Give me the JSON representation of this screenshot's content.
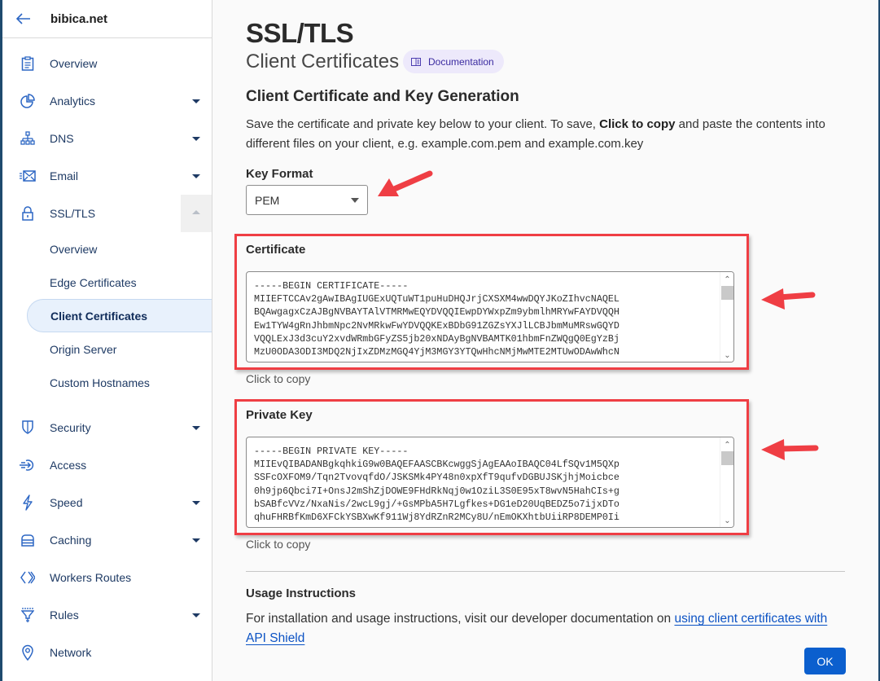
{
  "sidebar": {
    "site_name": "bibica.net",
    "back_icon": "arrow-left-icon",
    "items": [
      {
        "label": "Overview",
        "icon": "clipboard-icon",
        "has_caret": false
      },
      {
        "label": "Analytics",
        "icon": "pie-chart-icon",
        "has_caret": true
      },
      {
        "label": "DNS",
        "icon": "network-tree-icon",
        "has_caret": true
      },
      {
        "label": "Email",
        "icon": "email-icon",
        "has_caret": true
      },
      {
        "label": "SSL/TLS",
        "icon": "lock-icon",
        "expanded": true,
        "sub_items": [
          {
            "label": "Overview"
          },
          {
            "label": "Edge Certificates"
          },
          {
            "label": "Client Certificates",
            "active": true
          },
          {
            "label": "Origin Server"
          },
          {
            "label": "Custom Hostnames"
          }
        ]
      },
      {
        "label": "Security",
        "icon": "shield-icon",
        "has_caret": true
      },
      {
        "label": "Access",
        "icon": "access-icon",
        "has_caret": false
      },
      {
        "label": "Speed",
        "icon": "lightning-icon",
        "has_caret": true
      },
      {
        "label": "Caching",
        "icon": "storage-icon",
        "has_caret": true
      },
      {
        "label": "Workers Routes",
        "icon": "workers-icon",
        "has_caret": false
      },
      {
        "label": "Rules",
        "icon": "funnel-icon",
        "has_caret": true
      },
      {
        "label": "Network",
        "icon": "location-pin-icon",
        "has_caret": false
      }
    ]
  },
  "header": {
    "title": "SSL/TLS",
    "subtitle": "Client Certificates",
    "doc_badge": "Documentation"
  },
  "generation": {
    "heading": "Client Certificate and Key Generation",
    "desc_part1": "Save the certificate and private key below to your client. To save, ",
    "desc_bold": "Click to copy",
    "desc_part2": " and paste the contents into different files on your client, e.g. example.com.pem and example.com.key",
    "key_format_label": "Key Format",
    "key_format_value": "PEM"
  },
  "certificate": {
    "label": "Certificate",
    "content": "-----BEGIN CERTIFICATE-----\nMIIEFTCCAv2gAwIBAgIUGExUQTuWT1puHuDHQJrjCXSXM4wwDQYJKoZIhvcNAQEL\nBQAwgagxCzAJBgNVBAYTAlVTMRMwEQYDVQQIEwpDYWxpZm9ybmlhMRYwFAYDVQQH\nEw1TYW4gRnJhbmNpc2NvMRkwFwYDVQQKExBDbG91ZGZsYXJlLCBJbmMuMRswGQYD\nVQQLExJ3d3cuY2xvdWRmbGFyZS5jb20xNDAyBgNVBAMTK01hbmFnZWQgQ0EgYzBj\nMzU0ODA3ODI3MDQ2NjIxZDMzMGQ4YjM3MGY3YTQwHhcNMjMwMTE2MTUwODAwWhcN",
    "copy_hint": "Click to copy"
  },
  "private_key": {
    "label": "Private Key",
    "content": "-----BEGIN PRIVATE KEY-----\nMIIEvQIBADANBgkqhkiG9w0BAQEFAASCBKcwggSjAgEAAoIBAQC04LfSQv1M5QXp\nSSFcOXFOM9/Tqn2TvovqfdO/JSKSMk4PY48n0xpXfT9qufvDGBUJSKjhjMoicbce\n0h9jp6Qbci7I+OnsJ2mShZjDOWE9FHdRkNqj0w1OziL3S0E95xT8wvN5HahCIs+g\nbSABfcVVz/NxaNis/2wcL9gj/+GsMPbA5H7Lgfkes+DG1eD20UqBEDZ5o7ijxDTo\nqhuFHRBfKmD6XFCkYSBXwKf911Wj8YdRZnR2MCy8U/nEmOKXhtbUiiRP8DEMP0Ii",
    "copy_hint": "Click to copy"
  },
  "usage": {
    "heading": "Usage Instructions",
    "text": "For installation and usage instructions, visit our developer documentation on ",
    "link_text": "using client certificates with API Shield",
    "ok_label": "OK"
  },
  "colors": {
    "accent": "#0b5fce",
    "annotation_red": "#ef3e44",
    "sidebar_icon": "#2c66c4",
    "doc_badge_bg": "#ede9fb"
  }
}
